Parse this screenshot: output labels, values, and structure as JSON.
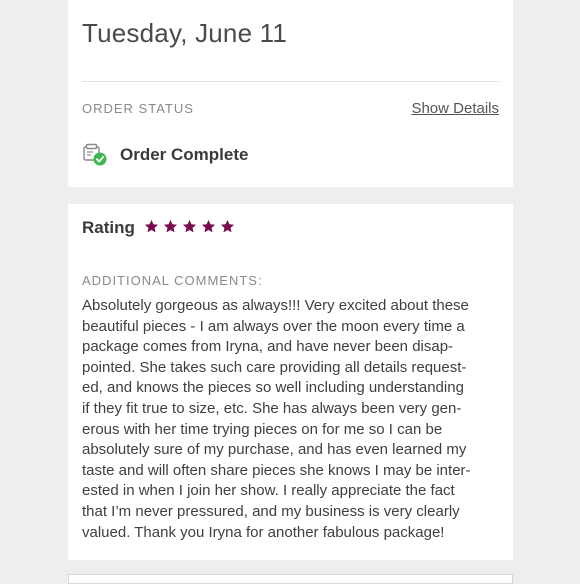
{
  "order": {
    "date": "Tuesday, June 11",
    "status_label": "ORDER STATUS",
    "show_details_label": "Show Details",
    "status_icon": "box-check-icon",
    "status_text": "Order Complete"
  },
  "review": {
    "rating_label": "Rating",
    "rating": 5,
    "rating_max": 5,
    "star_color": "#7a0a4f",
    "comments_label": "ADDITIONAL COMMENTS:",
    "comment_lines": [
      "Absolutely gorgeous as always!!! Very excited about these",
      "beautiful pieces - I am always over the moon every time a",
      "package comes from Iryna, and have never been disap-",
      "pointed. She takes such care providing all details request-",
      "ed, and knows the pieces so well including understanding",
      "if they fit true to size, etc. She has always been very gen-",
      "erous with her time trying pieces on for me so I can be",
      "absolutely sure of my purchase, and has even learned my",
      "taste and will often share pieces she knows I may be inter-",
      "ested in when I join her show. I really appreciate the fact",
      "that I’m never pressured, and my business is very clearly",
      "valued. Thank you Iryna for another fabulous package!"
    ]
  },
  "colors": {
    "background": "#eeeeee",
    "card": "#ffffff",
    "success": "#3cb94e",
    "star": "#7a0a4f"
  }
}
